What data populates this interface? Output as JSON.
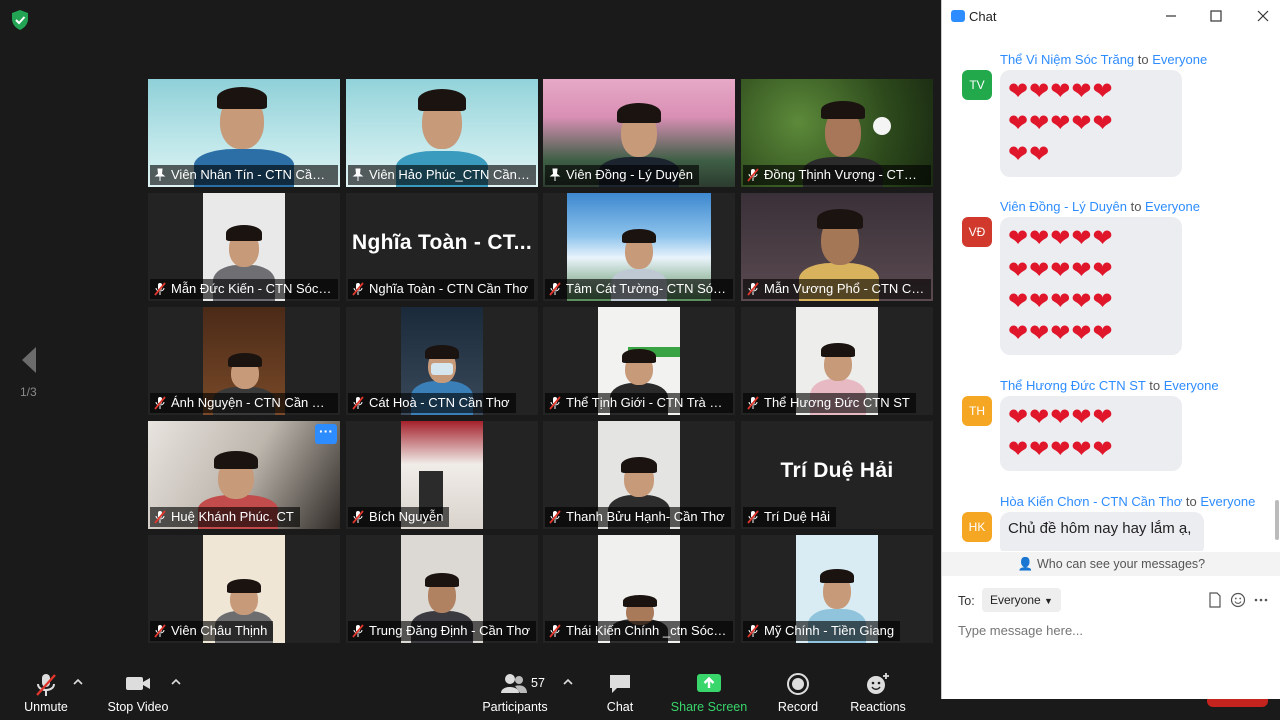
{
  "grid": {
    "tiles": [
      {
        "name": "Viên Nhân Tín - CTN Cần Thơ",
        "muted": false,
        "pinned": true
      },
      {
        "name": "Viên Hảo Phúc_CTN Cần Thơ",
        "muted": false,
        "pinned": true
      },
      {
        "name": "Viên Đồng - Lý Duyên",
        "muted": false,
        "pinned": true,
        "active": true
      },
      {
        "name": "Đồng Thịnh Vượng - CTN C...",
        "muted": true
      },
      {
        "name": "Mẫn Đức Kiến - CTN Sóc Tră...",
        "muted": true
      },
      {
        "name": "Nghĩa Toàn - CTN Cần Thơ",
        "muted": true,
        "display_text": "Nghĩa Toàn - CT..."
      },
      {
        "name": "Tâm Cát Tường- CTN Sóc Tr...",
        "muted": true
      },
      {
        "name": "Mẫn Vương Phổ - CTN Cần ...",
        "muted": true
      },
      {
        "name": "Ánh Nguyện - CTN Cần Thơ",
        "muted": true
      },
      {
        "name": "Cát Hoà - CTN Cần Thơ",
        "muted": true
      },
      {
        "name": "Thể Tịnh Giới - CTN Trà Vinh",
        "muted": true
      },
      {
        "name": "Thể Hương Đức CTN ST",
        "muted": true
      },
      {
        "name": "Huệ Khánh Phúc. CT",
        "muted": true,
        "more": "···"
      },
      {
        "name": "Bích Nguyễn",
        "muted": true
      },
      {
        "name": "Thanh Bửu Hạnh- Cần Thơ",
        "muted": true
      },
      {
        "name": "Trí Duệ Hải",
        "muted": true,
        "display_text": "Trí Duệ Hải"
      },
      {
        "name": "Viên Châu Thịnh",
        "muted": true
      },
      {
        "name": "Trung Đăng Định - Cần Thơ",
        "muted": true
      },
      {
        "name": "Thái Kiến Chính _ctn Sóc Tră...",
        "muted": true
      },
      {
        "name": "Mỹ Chính - Tiền Giang",
        "muted": true
      }
    ]
  },
  "pagination": {
    "page": "1/3"
  },
  "toolbar": {
    "unmute": "Unmute",
    "stop_video": "Stop Video",
    "participants": "Participants",
    "participants_count": "57",
    "chat": "Chat",
    "share_screen": "Share Screen",
    "record": "Record",
    "reactions": "Reactions"
  },
  "chat": {
    "title": "Chat",
    "to_word": "to",
    "messages": [
      {
        "initials": "TV",
        "avatar_color": "#22a94c",
        "sender": "Thể Vi Niệm Sóc Trăng",
        "recipient": "Everyone",
        "hearts": [
          "❤❤❤❤❤",
          "❤❤❤❤❤",
          "❤❤"
        ]
      },
      {
        "initials": "VĐ",
        "avatar_color": "#d0392b",
        "sender": "Viên Đồng - Lý Duyên",
        "recipient": "Everyone",
        "hearts": [
          "❤❤❤❤❤",
          "❤❤❤❤❤",
          "❤❤❤❤❤",
          "❤❤❤❤❤"
        ]
      },
      {
        "initials": "TH",
        "avatar_color": "#f5a623",
        "sender": "Thể Hương Đức CTN ST",
        "recipient": "Everyone",
        "hearts": [
          "❤❤❤❤❤",
          "❤❤❤❤❤"
        ]
      },
      {
        "initials": "HK",
        "avatar_color": "#f5a623",
        "sender": "Hòa Kiến Chơn - CTN Cần Thơ",
        "recipient": "Everyone",
        "text": "Chủ đề hôm nay hay lắm ạ,"
      }
    ],
    "who_can_see": "Who can see your messages?",
    "to_label": "To:",
    "to_value": "Everyone",
    "input_placeholder": "Type message here..."
  },
  "colors": {
    "accent": "#2d8cff",
    "share_green": "#38d66b",
    "active_speaker": "#d7e35b",
    "mute_red": "#e0362c"
  }
}
